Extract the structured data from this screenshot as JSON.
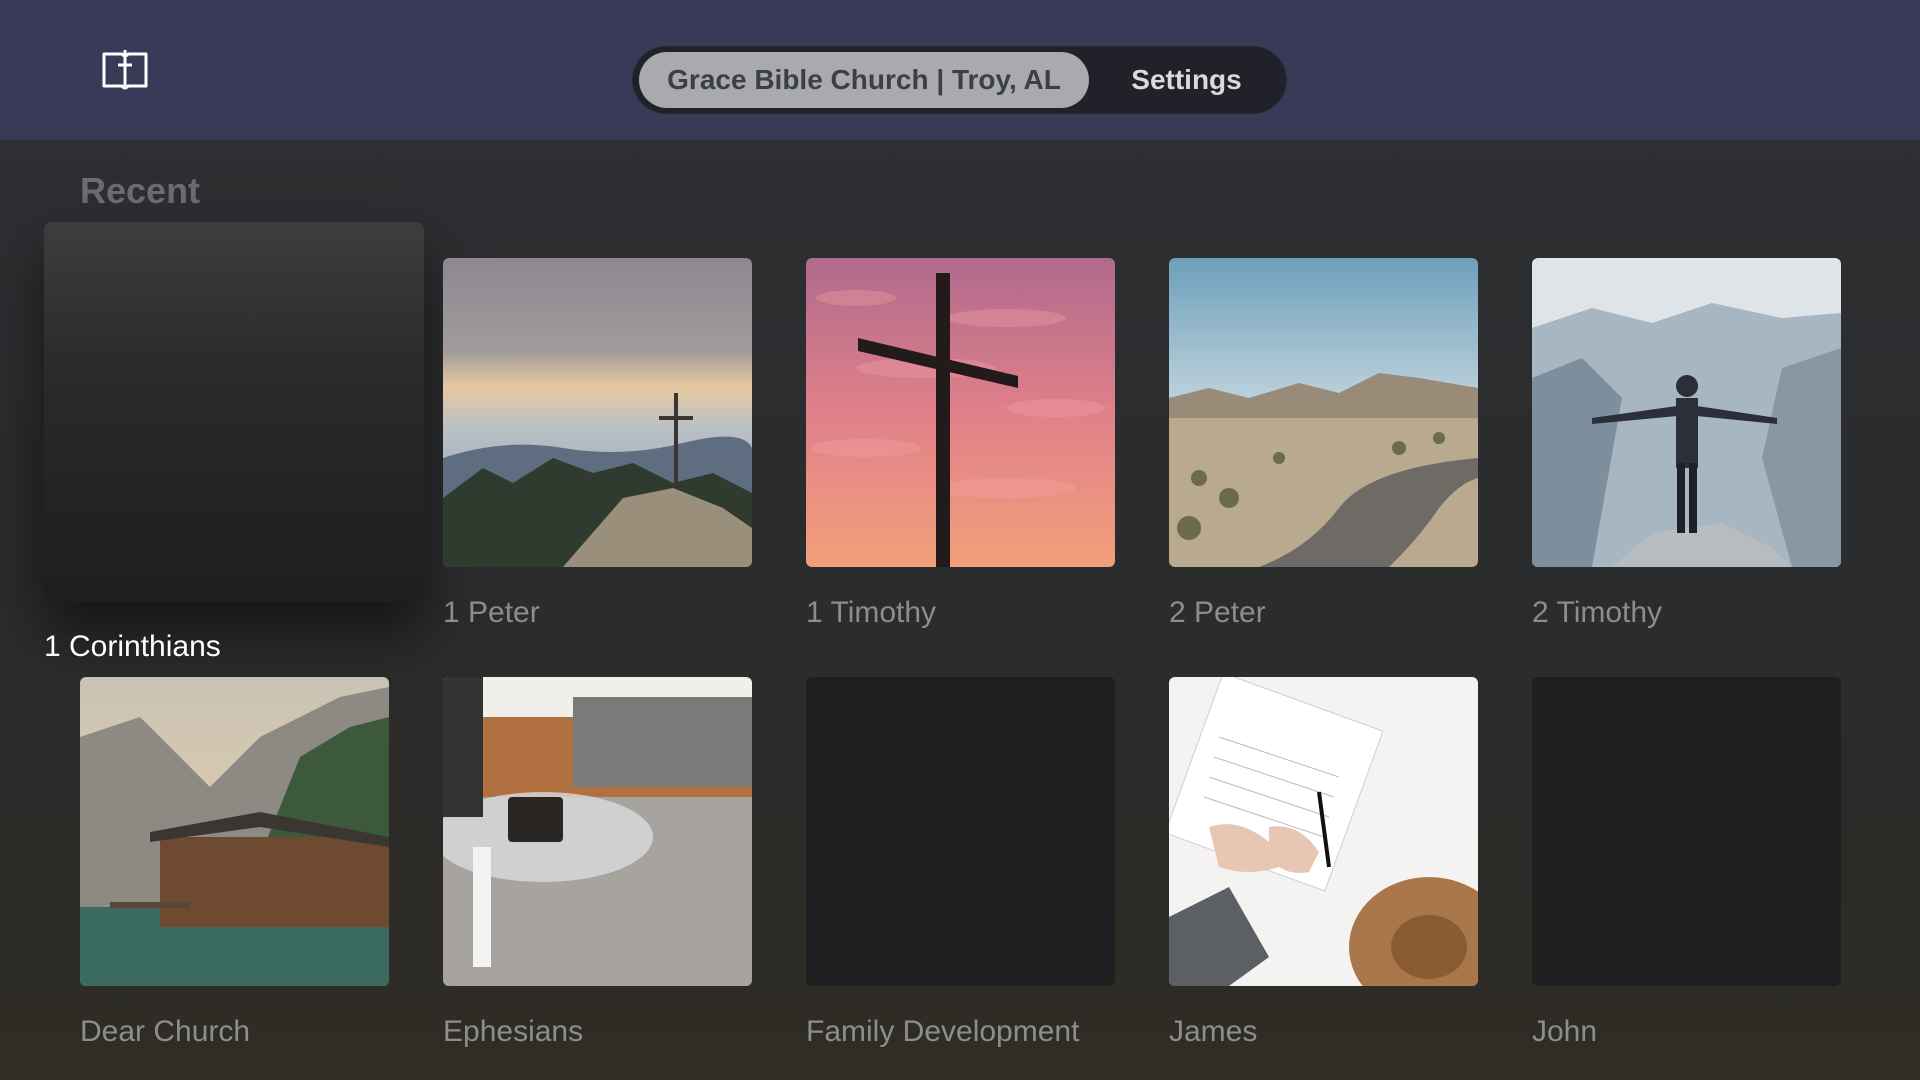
{
  "header": {
    "logo_icon": "bible-cross-icon",
    "tabs": [
      {
        "label": "Grace Bible Church | Troy, AL",
        "active": true
      },
      {
        "label": "Settings",
        "active": false
      }
    ]
  },
  "section": {
    "title": "Recent"
  },
  "items": [
    {
      "title": "1 Corinthians",
      "image": "blank-dark",
      "focused": true
    },
    {
      "title": "1 Peter",
      "image": "mountain-cross"
    },
    {
      "title": "1 Timothy",
      "image": "cross-sunset"
    },
    {
      "title": "2 Peter",
      "image": "desert-road"
    },
    {
      "title": "2 Timothy",
      "image": "man-on-cliff"
    },
    {
      "title": "Dear Church",
      "image": "lake-boathouse"
    },
    {
      "title": "Ephesians",
      "image": "coffee-table-rug"
    },
    {
      "title": "Family Development",
      "image": "blank-dark"
    },
    {
      "title": "James",
      "image": "planner-writing"
    },
    {
      "title": "John",
      "image": "blank-dark"
    }
  ],
  "colors": {
    "header_bg": "#383a58",
    "tab_active_bg": "#a9aab0",
    "page_bg": "#2c2c2e"
  }
}
